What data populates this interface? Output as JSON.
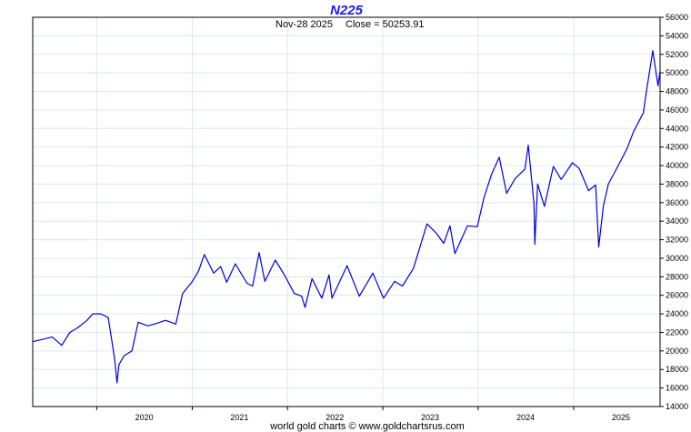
{
  "chart_data": {
    "type": "line",
    "title": "N225",
    "subtitle": {
      "date": "Nov-28  2025",
      "close": "Close = 50253.91"
    },
    "footer": "world gold charts © www.goldchartsrus.com",
    "title_color": "#1a1aff",
    "line_color": "#0000dd",
    "grid_color": "#d8e8f0",
    "grid": true,
    "xlim": [
      "2019-05-01",
      "2025-11-28"
    ],
    "ylim": [
      14000,
      56000
    ],
    "x_ticks": [
      "2020",
      "2021",
      "2022",
      "2023",
      "2024",
      "2025"
    ],
    "y_ticks": [
      "14000",
      "16000",
      "18000",
      "20000",
      "22000",
      "24000",
      "26000",
      "28000",
      "30000",
      "32000",
      "34000",
      "36000",
      "38000",
      "40000",
      "42000",
      "44000",
      "46000",
      "48000",
      "50000",
      "52000",
      "54000",
      "56000"
    ],
    "series": [
      {
        "points": [
          [
            "2019-05-01",
            21000
          ],
          [
            "2019-06-01",
            21200
          ],
          [
            "2019-07-15",
            21500
          ],
          [
            "2019-08-20",
            20600
          ],
          [
            "2019-09-20",
            22000
          ],
          [
            "2019-10-20",
            22500
          ],
          [
            "2019-11-25",
            23300
          ],
          [
            "2019-12-17",
            24000
          ],
          [
            "2020-01-17",
            24000
          ],
          [
            "2020-02-14",
            23600
          ],
          [
            "2020-02-28",
            21100
          ],
          [
            "2020-03-10",
            19000
          ],
          [
            "2020-03-19",
            16550
          ],
          [
            "2020-03-26",
            18500
          ],
          [
            "2020-04-15",
            19500
          ],
          [
            "2020-05-15",
            20000
          ],
          [
            "2020-06-08",
            23100
          ],
          [
            "2020-07-15",
            22700
          ],
          [
            "2020-08-20",
            23000
          ],
          [
            "2020-09-20",
            23300
          ],
          [
            "2020-10-30",
            22900
          ],
          [
            "2020-11-25",
            26200
          ],
          [
            "2020-12-30",
            27400
          ],
          [
            "2021-01-25",
            28600
          ],
          [
            "2021-02-16",
            30400
          ],
          [
            "2021-03-24",
            28400
          ],
          [
            "2021-04-20",
            29100
          ],
          [
            "2021-05-13",
            27400
          ],
          [
            "2021-06-15",
            29400
          ],
          [
            "2021-07-30",
            27300
          ],
          [
            "2021-08-20",
            27000
          ],
          [
            "2021-09-14",
            30600
          ],
          [
            "2021-10-06",
            27500
          ],
          [
            "2021-11-15",
            29800
          ],
          [
            "2021-12-20",
            28200
          ],
          [
            "2022-01-27",
            26200
          ],
          [
            "2022-02-24",
            25900
          ],
          [
            "2022-03-09",
            24700
          ],
          [
            "2022-04-05",
            27800
          ],
          [
            "2022-05-12",
            25700
          ],
          [
            "2022-06-09",
            28200
          ],
          [
            "2022-06-20",
            25700
          ],
          [
            "2022-08-17",
            29200
          ],
          [
            "2022-10-03",
            25900
          ],
          [
            "2022-11-24",
            28400
          ],
          [
            "2022-12-28",
            26100
          ],
          [
            "2023-01-04",
            25700
          ],
          [
            "2023-02-15",
            27500
          ],
          [
            "2023-03-17",
            27000
          ],
          [
            "2023-04-28",
            28900
          ],
          [
            "2023-06-19",
            33700
          ],
          [
            "2023-07-25",
            32700
          ],
          [
            "2023-08-22",
            31600
          ],
          [
            "2023-09-15",
            33500
          ],
          [
            "2023-10-04",
            30500
          ],
          [
            "2023-11-21",
            33500
          ],
          [
            "2023-12-29",
            33400
          ],
          [
            "2024-01-23",
            36500
          ],
          [
            "2024-02-22",
            39100
          ],
          [
            "2024-03-22",
            40900
          ],
          [
            "2024-04-19",
            37000
          ],
          [
            "2024-05-22",
            38600
          ],
          [
            "2024-06-28",
            39600
          ],
          [
            "2024-07-11",
            42200
          ],
          [
            "2024-08-02",
            35900
          ],
          [
            "2024-08-05",
            31500
          ],
          [
            "2024-08-16",
            38000
          ],
          [
            "2024-09-11",
            35600
          ],
          [
            "2024-10-15",
            39900
          ],
          [
            "2024-11-14",
            38500
          ],
          [
            "2024-12-27",
            40300
          ],
          [
            "2025-01-22",
            39700
          ],
          [
            "2025-02-27",
            37300
          ],
          [
            "2025-03-26",
            37900
          ],
          [
            "2025-04-07",
            31200
          ],
          [
            "2025-04-25",
            35700
          ],
          [
            "2025-05-14",
            38000
          ],
          [
            "2025-06-30",
            40500
          ],
          [
            "2025-07-24",
            41800
          ],
          [
            "2025-08-19",
            43700
          ],
          [
            "2025-09-25",
            45700
          ],
          [
            "2025-10-06",
            47900
          ],
          [
            "2025-10-31",
            52400
          ],
          [
            "2025-11-20",
            48600
          ],
          [
            "2025-11-28",
            50254
          ]
        ]
      }
    ]
  }
}
